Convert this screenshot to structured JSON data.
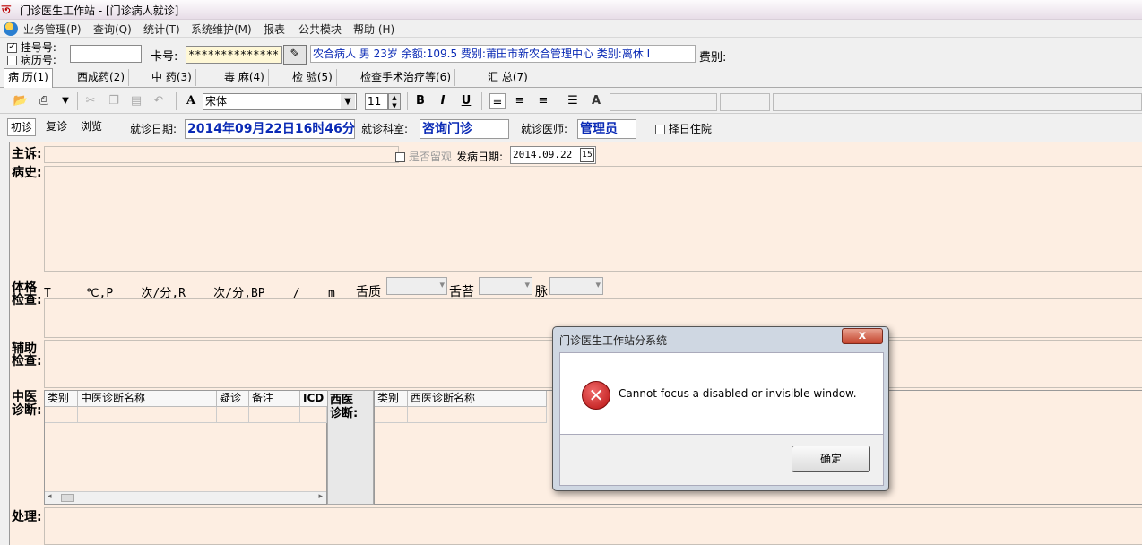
{
  "window": {
    "title": "门诊医生工作站 - [门诊病人就诊]"
  },
  "menu": [
    "业务管理(P)",
    "查询(Q)",
    "统计(T)",
    "系统维护(M)",
    "报表",
    "公共模块",
    "帮助 (H)"
  ],
  "patient": {
    "reg_label": "挂号号:",
    "record_label": "病历号:",
    "card_label": "卡号:",
    "card_value": "**************",
    "info": "农合病人 男 23岁 余额:109.5 费别:莆田市新农合管理中心 类别:离休 Ⅰ",
    "fee_label": "费别:",
    "reg_checked": true,
    "record_checked": false
  },
  "tabs": [
    "病 历(1)",
    "西成药(2)",
    "中 药(3)",
    "毒 麻(4)",
    "检 验(5)",
    "检查手术治疗等(6)",
    "汇 总(7)"
  ],
  "toolbar": {
    "font_name": "宋体",
    "font_size": "11",
    "bold": "B",
    "italic": "I",
    "underline": "U",
    "font_color": "A"
  },
  "visit": {
    "modes": [
      "初诊",
      "复诊",
      "浏览"
    ],
    "date_label": "就诊日期:",
    "date_value": "2014年09月22日16时46分",
    "dept_label": "就诊科室:",
    "dept_value": "咨询门诊",
    "doctor_label": "就诊医师:",
    "doctor_value": "管理员",
    "hospital_label": "择日住院"
  },
  "record": {
    "complaint_label": "主诉:",
    "observe_label": "是否留观",
    "onset_label": "发病日期:",
    "onset_value": "2014.09.22",
    "history_label": "病史:",
    "exam_label_1": "体格",
    "exam_label_2": "检查:",
    "vitals_line": "T_____℃,P____次/分,R____次/分,BP____/____m",
    "tongue_label": "舌质",
    "coating_label": "舌苔",
    "pulse_label": "脉",
    "aux_label_1": "辅助",
    "aux_label_2": "检查:",
    "tcm_label_1": "中医",
    "tcm_label_2": "诊断:",
    "tcm_cols": [
      "类别",
      "中医诊断名称",
      "疑诊",
      "备注",
      "ICD"
    ],
    "wm_label_1": "西医",
    "wm_label_2": "诊断:",
    "wm_cols": [
      "类别",
      "西医诊断名称"
    ],
    "treat_label": "处理:"
  },
  "dialog": {
    "title": "门诊医生工作站分系统",
    "message": "Cannot focus a disabled or invisible window.",
    "ok_label": "确定",
    "close_label": "x"
  }
}
